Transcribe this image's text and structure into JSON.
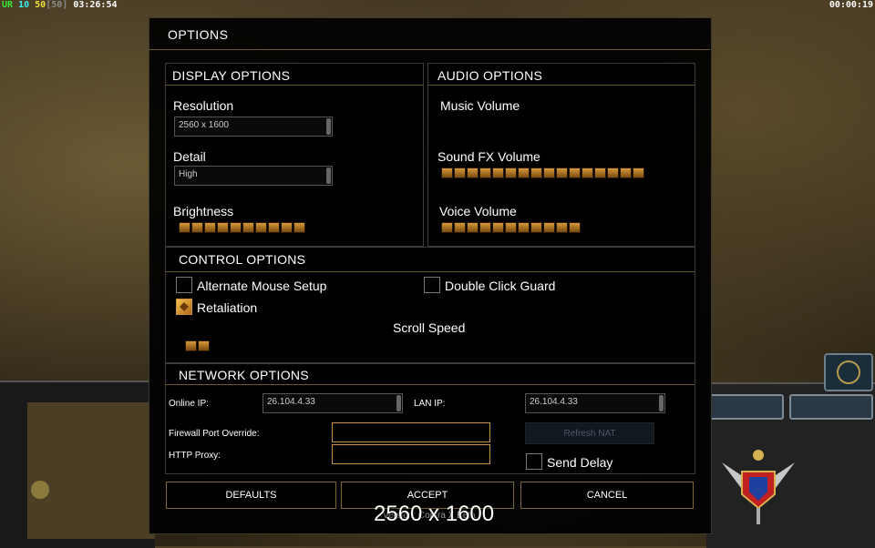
{
  "hud": {
    "ur": "UR",
    "ten": "10",
    "fifty": "50",
    "bracket": "[50]",
    "clock": "03:26:54",
    "timer": "00:00:19"
  },
  "colors": {
    "ur": "#39e639",
    "ten": "#3af0f0",
    "fifty": "#f0e03a",
    "bracket": "#888888",
    "accent": "#c89040"
  },
  "dialog": {
    "title": "OPTIONS"
  },
  "display": {
    "heading": "DISPLAY OPTIONS",
    "resolution_label": "Resolution",
    "resolution_value": "2560 x 1600",
    "detail_label": "Detail",
    "detail_value": "High",
    "brightness_label": "Brightness",
    "brightness_level": 10
  },
  "audio": {
    "heading": "AUDIO OPTIONS",
    "music_label": "Music Volume",
    "music_level": 0,
    "sfx_label": "Sound FX Volume",
    "sfx_level": 16,
    "voice_label": "Voice Volume",
    "voice_level": 11
  },
  "control": {
    "heading": "CONTROL OPTIONS",
    "alt_mouse_label": "Alternate Mouse Setup",
    "alt_mouse_checked": false,
    "double_click_label": "Double Click Guard",
    "double_click_checked": false,
    "retaliation_label": "Retaliation",
    "retaliation_checked": true,
    "scroll_label": "Scroll Speed",
    "scroll_level": 2
  },
  "network": {
    "heading": "NETWORK OPTIONS",
    "online_ip_label": "Online IP:",
    "online_ip_value": "26.104.4.33",
    "lan_ip_label": "LAN IP:",
    "lan_ip_value": "26.104.4.33",
    "firewall_label": "Firewall Port Override:",
    "proxy_label": "HTTP Proxy:",
    "refresh_label": "Refresh NAT",
    "send_delay_label": "Send Delay",
    "send_delay_checked": false
  },
  "buttons": {
    "defaults": "DEFAULTS",
    "accept": "ACCEPT",
    "cancel": "CANCEL"
  },
  "footer": {
    "version": "Version: Contra X Beta",
    "overlay": "2560 x 1600"
  },
  "icons": [
    "radar-icon",
    "faction-emblem-icon",
    "scroll-arrow-icon"
  ]
}
